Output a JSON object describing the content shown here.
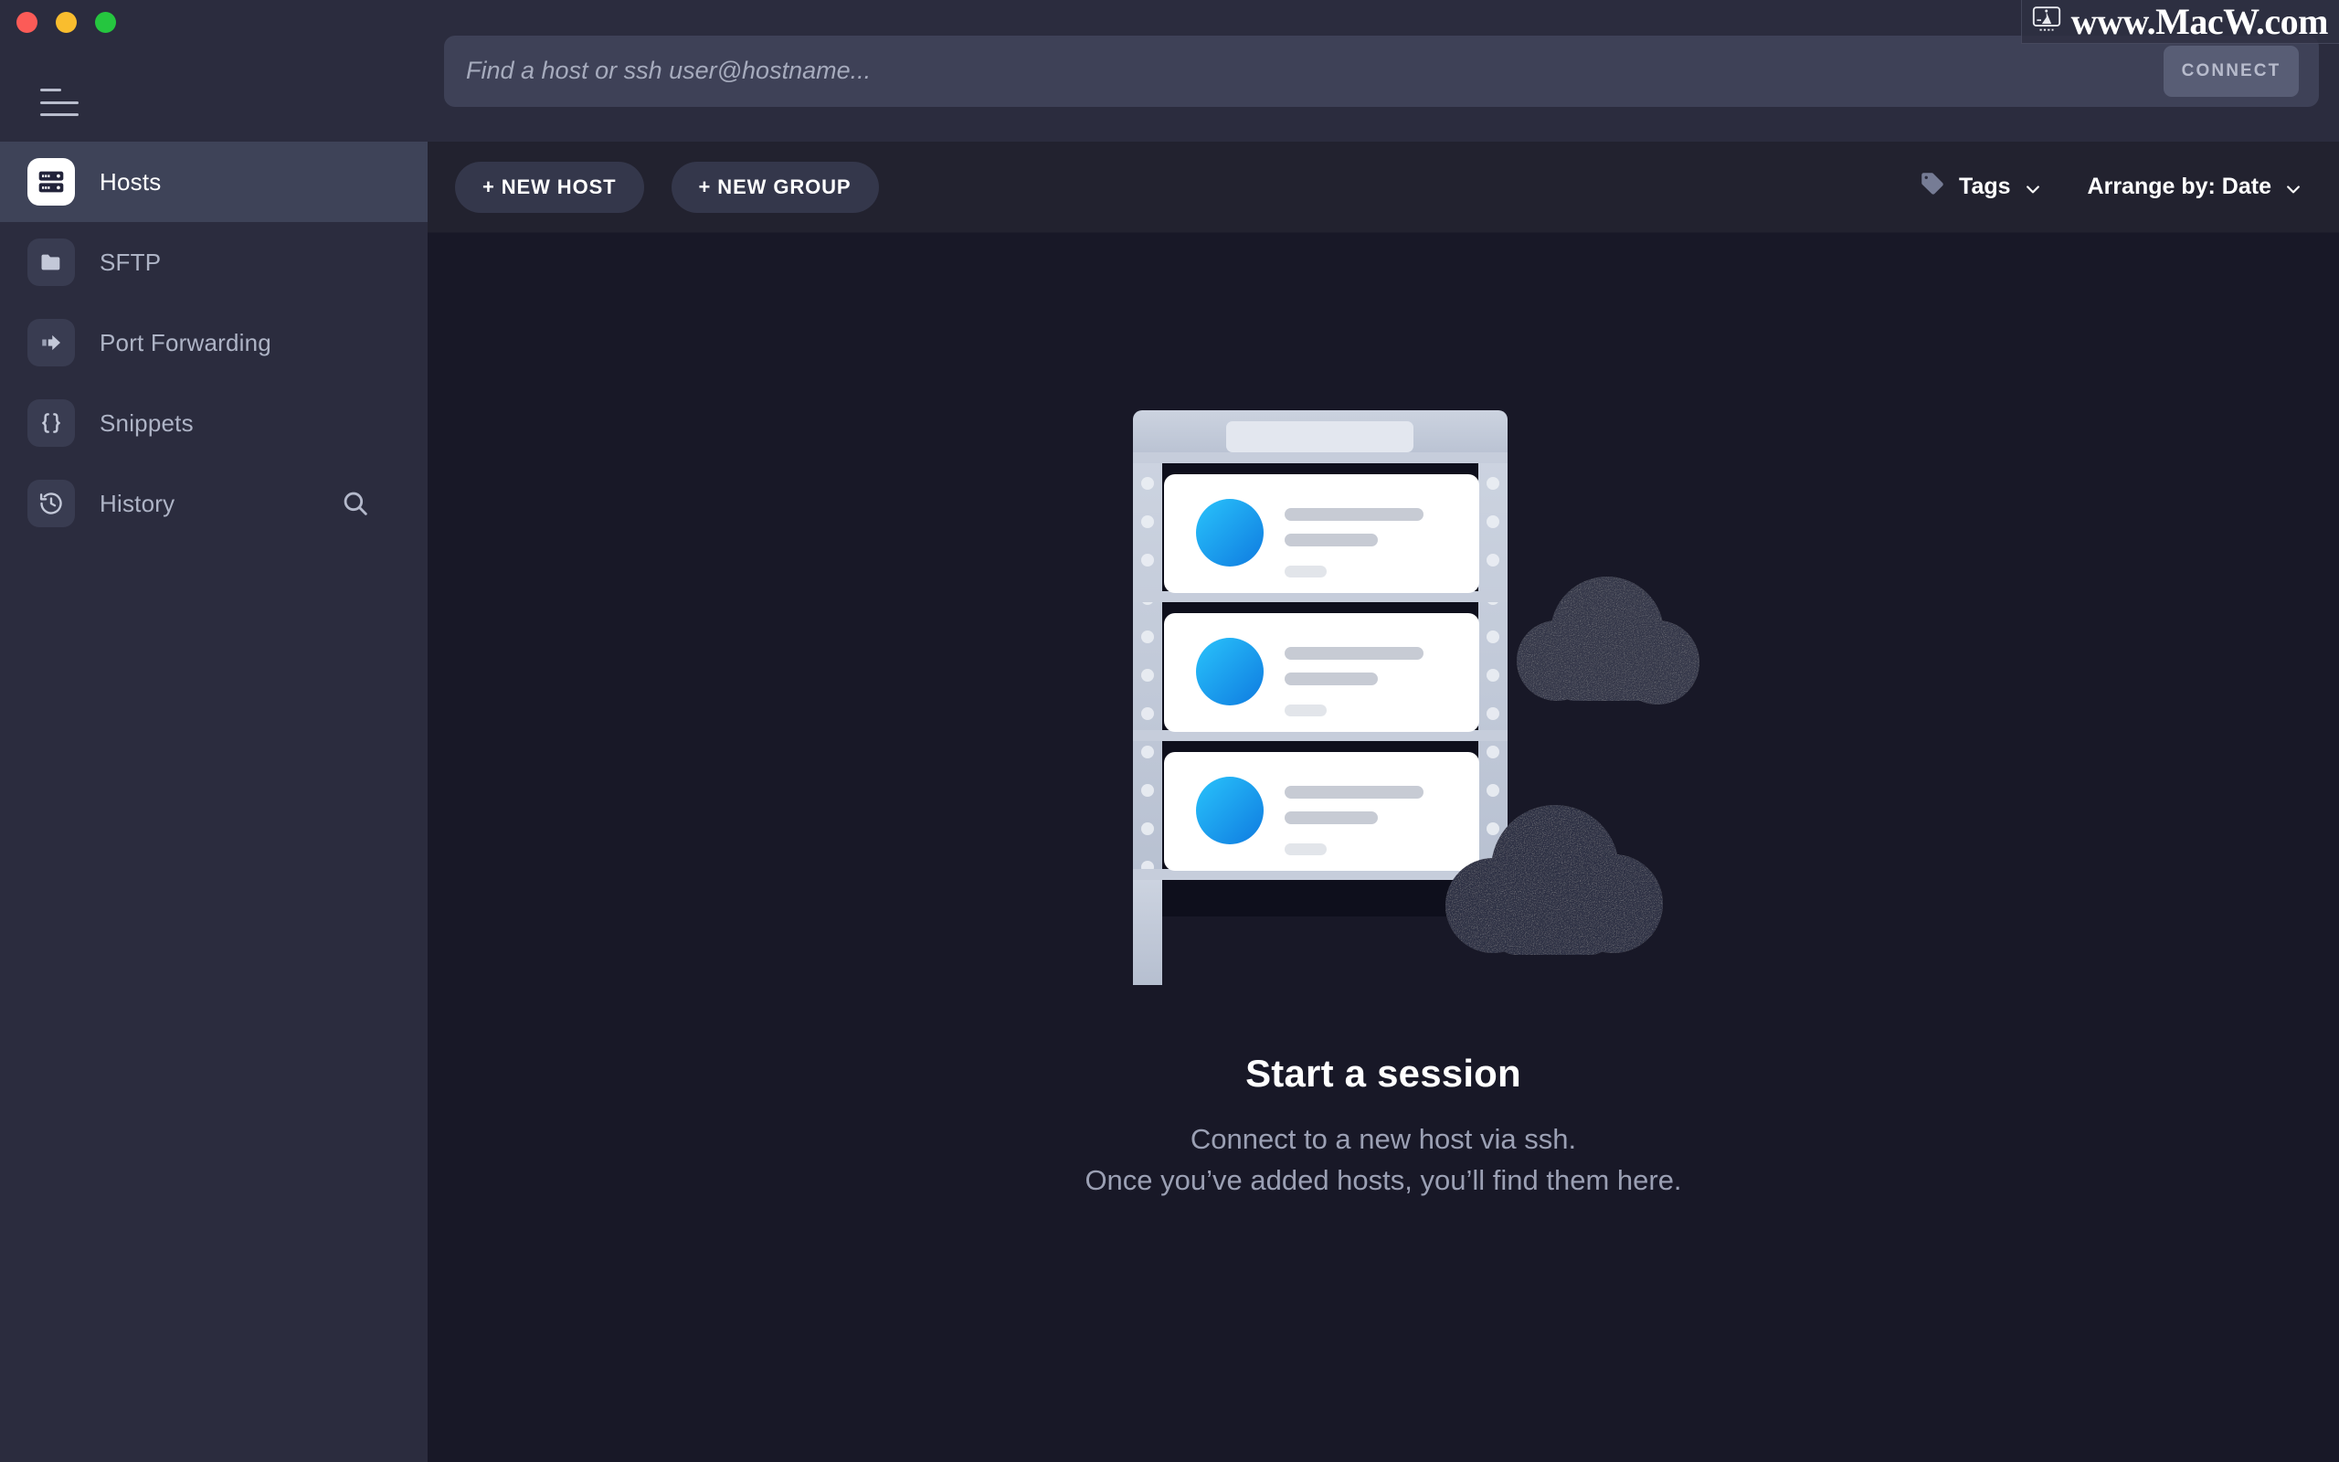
{
  "window": {
    "traffic_lights": [
      "close",
      "minimize",
      "zoom"
    ],
    "colors": {
      "sidebar_bg": "#2b2c3e",
      "content_bg": "#181827",
      "active_row": "#3e4358",
      "accent_blue": "#1b9dfb",
      "close": "#fc5b57",
      "minimize": "#f9bd2e",
      "zoom": "#25c63f"
    }
  },
  "sidebar": {
    "menu_button": "menu",
    "items": [
      {
        "label": "Hosts",
        "icon": "server-rack-icon",
        "active": true
      },
      {
        "label": "SFTP",
        "icon": "folder-icon",
        "active": false
      },
      {
        "label": "Port Forwarding",
        "icon": "forward-arrow-icon",
        "active": false
      },
      {
        "label": "Snippets",
        "icon": "curly-braces-icon",
        "active": false
      },
      {
        "label": "History",
        "icon": "clock-history-icon",
        "active": false
      }
    ],
    "search_icon": "search-icon"
  },
  "search": {
    "placeholder": "Find a host or ssh user@hostname...",
    "value": "",
    "connect_label": "CONNECT"
  },
  "toolbar": {
    "new_host_label": "+ NEW HOST",
    "new_group_label": "+ NEW GROUP",
    "tags_label": "Tags",
    "tags_icon": "tag-icon",
    "arrange_label": "Arrange by: Date",
    "chevron_icon": "chevron-down-icon"
  },
  "empty_state": {
    "illustration": "server-rack-with-clouds",
    "title": "Start a session",
    "line1": "Connect to a new host via ssh.",
    "line2": "Once you’ve added hosts, you’ll find them here."
  },
  "watermark": {
    "text": "www.MacW.com",
    "icon": "monitor-icon"
  }
}
